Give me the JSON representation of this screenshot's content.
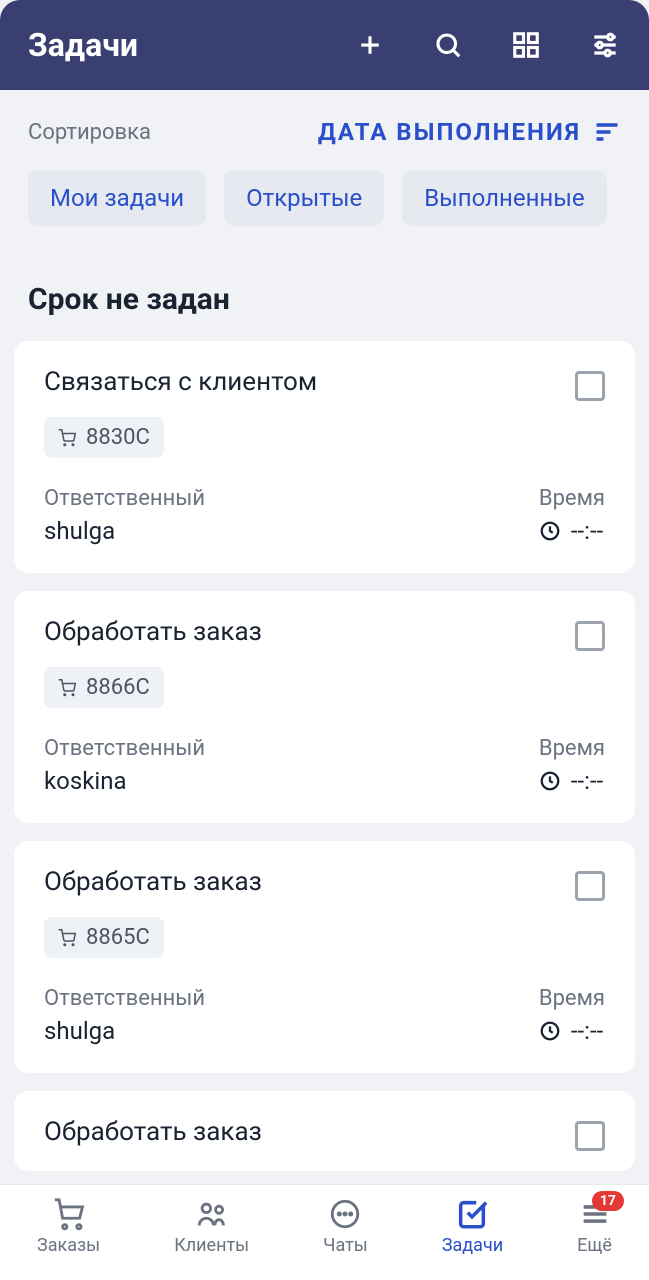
{
  "header": {
    "title": "Задачи"
  },
  "sort": {
    "label": "Сортировка",
    "value": "ДАТА ВЫПОЛНЕНИЯ"
  },
  "chips": [
    "Мои задачи",
    "Открытые",
    "Выполненные"
  ],
  "section_title": "Срок не задан",
  "meta_labels": {
    "assignee": "Ответственный",
    "time": "Время"
  },
  "tasks": [
    {
      "title": "Связаться с клиентом",
      "tag": "8830C",
      "assignee": "shulga",
      "time": "--:--"
    },
    {
      "title": "Обработать заказ",
      "tag": "8866C",
      "assignee": "koskina",
      "time": "--:--"
    },
    {
      "title": "Обработать заказ",
      "tag": "8865C",
      "assignee": "shulga",
      "time": "--:--"
    },
    {
      "title": "Обработать заказ",
      "tag": "",
      "assignee": "",
      "time": ""
    }
  ],
  "nav": {
    "items": [
      {
        "label": "Заказы"
      },
      {
        "label": "Клиенты"
      },
      {
        "label": "Чаты"
      },
      {
        "label": "Задачи"
      },
      {
        "label": "Ещё",
        "badge": "17"
      }
    ]
  }
}
